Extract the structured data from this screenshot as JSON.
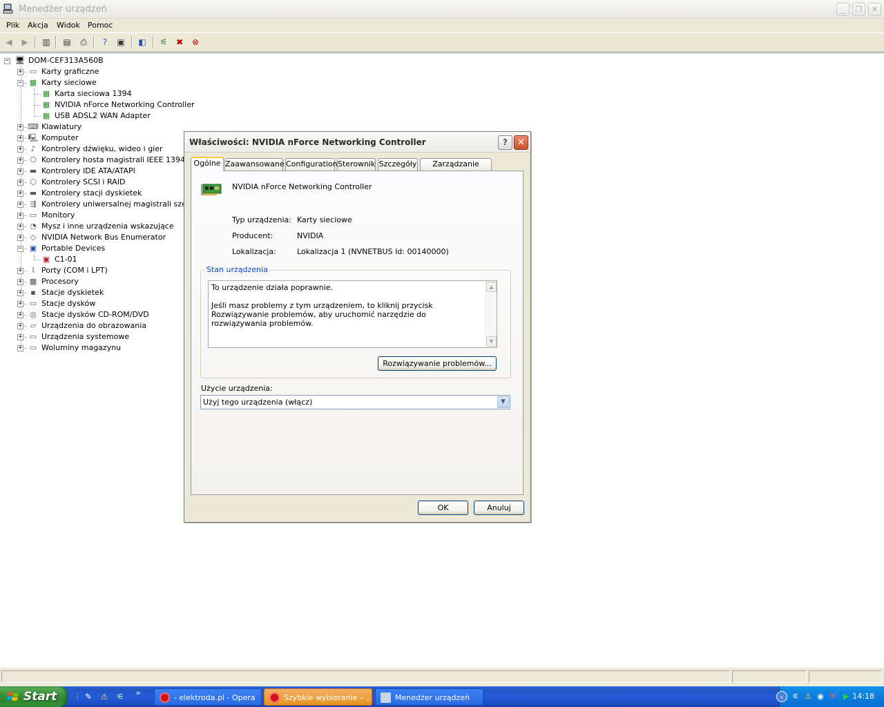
{
  "window": {
    "title": "Menedżer urządzeń"
  },
  "menu": [
    "Plik",
    "Akcja",
    "Widok",
    "Pomoc"
  ],
  "tree": {
    "root": "DOM-CEF313A560B",
    "items": [
      {
        "label": "Karty graficzne",
        "icon": "display-adapter-icon",
        "expanded": false
      },
      {
        "label": "Karty sieciowe",
        "icon": "network-card-icon",
        "expanded": true,
        "children": [
          "Karta sieciowa 1394",
          "NVIDIA nForce Networking Controller",
          "USB ADSL2 WAN Adapter"
        ]
      },
      {
        "label": "Klawiatury",
        "icon": "keyboard-icon",
        "expanded": false
      },
      {
        "label": "Komputer",
        "icon": "computer-icon",
        "expanded": false
      },
      {
        "label": "Kontrolery dźwięku, wideo i gier",
        "icon": "sound-icon",
        "expanded": false
      },
      {
        "label": "Kontrolery hosta magistrali IEEE 1394",
        "icon": "ieee1394-icon",
        "expanded": false
      },
      {
        "label": "Kontrolery IDE ATA/ATAPI",
        "icon": "ide-icon",
        "expanded": false
      },
      {
        "label": "Kontrolery SCSI i RAID",
        "icon": "scsi-icon",
        "expanded": false
      },
      {
        "label": "Kontrolery stacji dyskietek",
        "icon": "floppy-controller-icon",
        "expanded": false
      },
      {
        "label": "Kontrolery uniwersalnej magistrali szeregow",
        "icon": "usb-icon",
        "expanded": false
      },
      {
        "label": "Monitory",
        "icon": "monitor-icon",
        "expanded": false
      },
      {
        "label": "Mysz i inne urządzenia wskazujące",
        "icon": "mouse-icon",
        "expanded": false
      },
      {
        "label": "NVIDIA Network Bus Enumerator",
        "icon": "bus-enumerator-icon",
        "expanded": false
      },
      {
        "label": "Portable Devices",
        "icon": "portable-device-icon",
        "expanded": true,
        "children": [
          "C1-01"
        ]
      },
      {
        "label": "Porty (COM i LPT)",
        "icon": "port-icon",
        "expanded": false
      },
      {
        "label": "Procesory",
        "icon": "processor-icon",
        "expanded": false
      },
      {
        "label": "Stacje dyskietek",
        "icon": "floppy-drive-icon",
        "expanded": false
      },
      {
        "label": "Stacje dysków",
        "icon": "disk-drive-icon",
        "expanded": false
      },
      {
        "label": "Stacje dysków CD-ROM/DVD",
        "icon": "cdrom-icon",
        "expanded": false
      },
      {
        "label": "Urządzenia do obrazowania",
        "icon": "imaging-icon",
        "expanded": false
      },
      {
        "label": "Urządzenia systemowe",
        "icon": "system-device-icon",
        "expanded": false
      },
      {
        "label": "Woluminy magazynu",
        "icon": "storage-volume-icon",
        "expanded": false
      }
    ]
  },
  "dialog": {
    "title": "Właściwości: NVIDIA nForce Networking Controller",
    "tabs": [
      "Ogólne",
      "Zaawansowane",
      "Configuration",
      "Sterownik",
      "Szczegóły",
      "Zarządzanie energią"
    ],
    "active_tab": "Ogólne",
    "device_name": "NVIDIA nForce Networking Controller",
    "props": [
      {
        "label": "Typ urządzenia:",
        "value": "Karty sieciowe"
      },
      {
        "label": "Producent:",
        "value": "NVIDIA"
      },
      {
        "label": "Lokalizacja:",
        "value": "Lokalizacja 1 (NVNETBUS Id: 00140000)"
      }
    ],
    "status_group": "Stan urządzenia",
    "status_line1": "To urządzenie działa poprawnie.",
    "status_line2": "Jeśli masz problemy z tym urządzeniem, to kliknij przycisk Rozwiązywanie problemów, aby uruchomić narzędzie do rozwiązywania problemów.",
    "troubleshoot_button": "Rozwiązywanie problemów...",
    "usage_label": "Użycie urządzenia:",
    "usage_value": "Użyj tego urządzenia (włącz)",
    "ok": "OK",
    "cancel": "Anuluj"
  },
  "taskbar": {
    "start": "Start",
    "items": [
      {
        "label": "- elektroda.pl - Opera",
        "active": false
      },
      {
        "label": "Szybkie wybieranie – ...",
        "active": false
      },
      {
        "label": "Menedżer urządzeń",
        "active": true
      }
    ],
    "clock": "14:18"
  },
  "colors": {
    "taskbar_blue": "#245ad8",
    "start_green": "#3c8f3c",
    "tab_accent": "#ffc83c",
    "group_title": "#0046d5",
    "close_red": "#c8502c"
  }
}
